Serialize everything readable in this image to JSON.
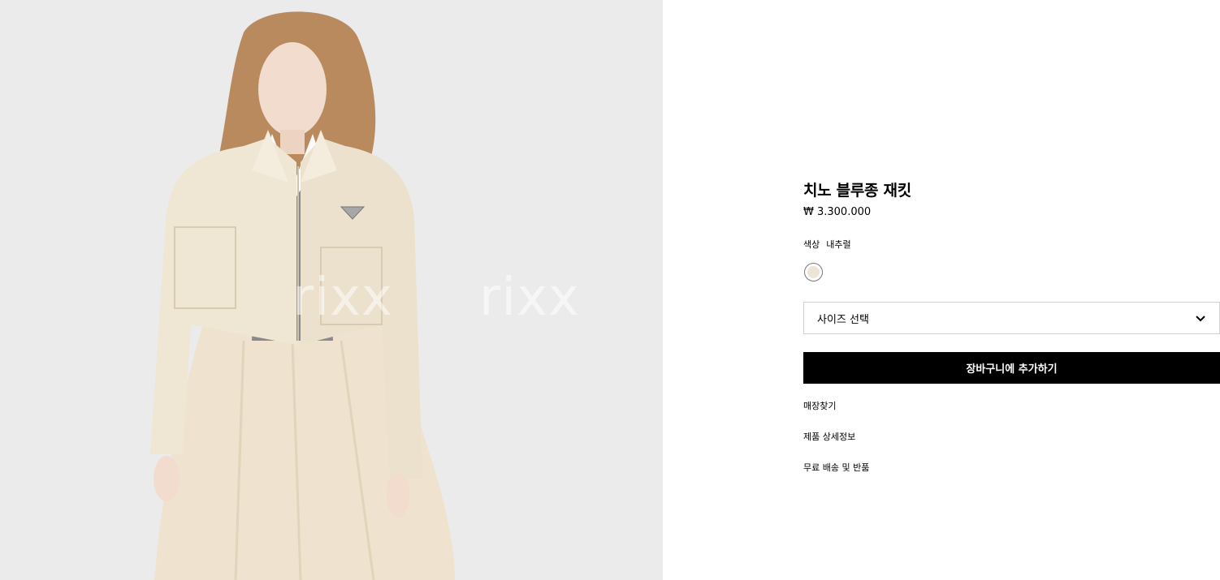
{
  "product": {
    "name": "치노 블루종 재킷",
    "price": "₩ 3.300.000",
    "color_label": "색상",
    "color_value": "내추럴",
    "swatch_color": "#ece4d6"
  },
  "size_select": {
    "label": "사이즈 선택",
    "icon": "chevron-down-icon"
  },
  "actions": {
    "add_to_cart": "장바구니에 추가하기"
  },
  "links": {
    "store_finder": "매장찾기",
    "product_details": "제품 상세정보",
    "shipping_returns": "무료 배송 및 반품"
  },
  "watermark": {
    "text": "rixx"
  },
  "colors": {
    "image_background": "#ebebeb",
    "button_background": "#000000",
    "button_text": "#ffffff"
  }
}
